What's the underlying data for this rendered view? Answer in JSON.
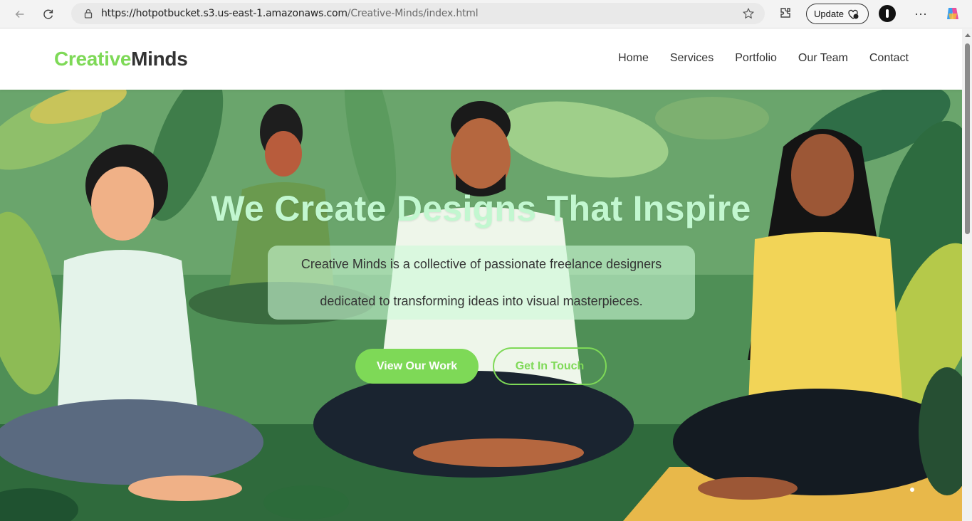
{
  "browser": {
    "url_host": "https://hotpotbucket.s3.us-east-1.amazonaws.com",
    "url_path": "/Creative-Minds/index.html",
    "update_label": "Update",
    "icons": [
      "back-arrow-icon",
      "reload-icon",
      "lock-icon",
      "star-icon",
      "extensions-icon",
      "profile-icon",
      "more-icon",
      "copilot-icon"
    ]
  },
  "site": {
    "logo_first": "Creative",
    "logo_second": "Minds",
    "nav": [
      "Home",
      "Services",
      "Portfolio",
      "Our Team",
      "Contact"
    ],
    "colors": {
      "accent": "#7ed957",
      "title": "#c2f7d0",
      "text": "#333333"
    }
  },
  "hero": {
    "title": "We Create Designs That Inspire",
    "line1": "Creative Minds is a collective of passionate freelance designers",
    "line2": "dedicated to transforming ideas into visual masterpieces.",
    "primary_button": "View Our Work",
    "secondary_button": "Get In Touch"
  }
}
